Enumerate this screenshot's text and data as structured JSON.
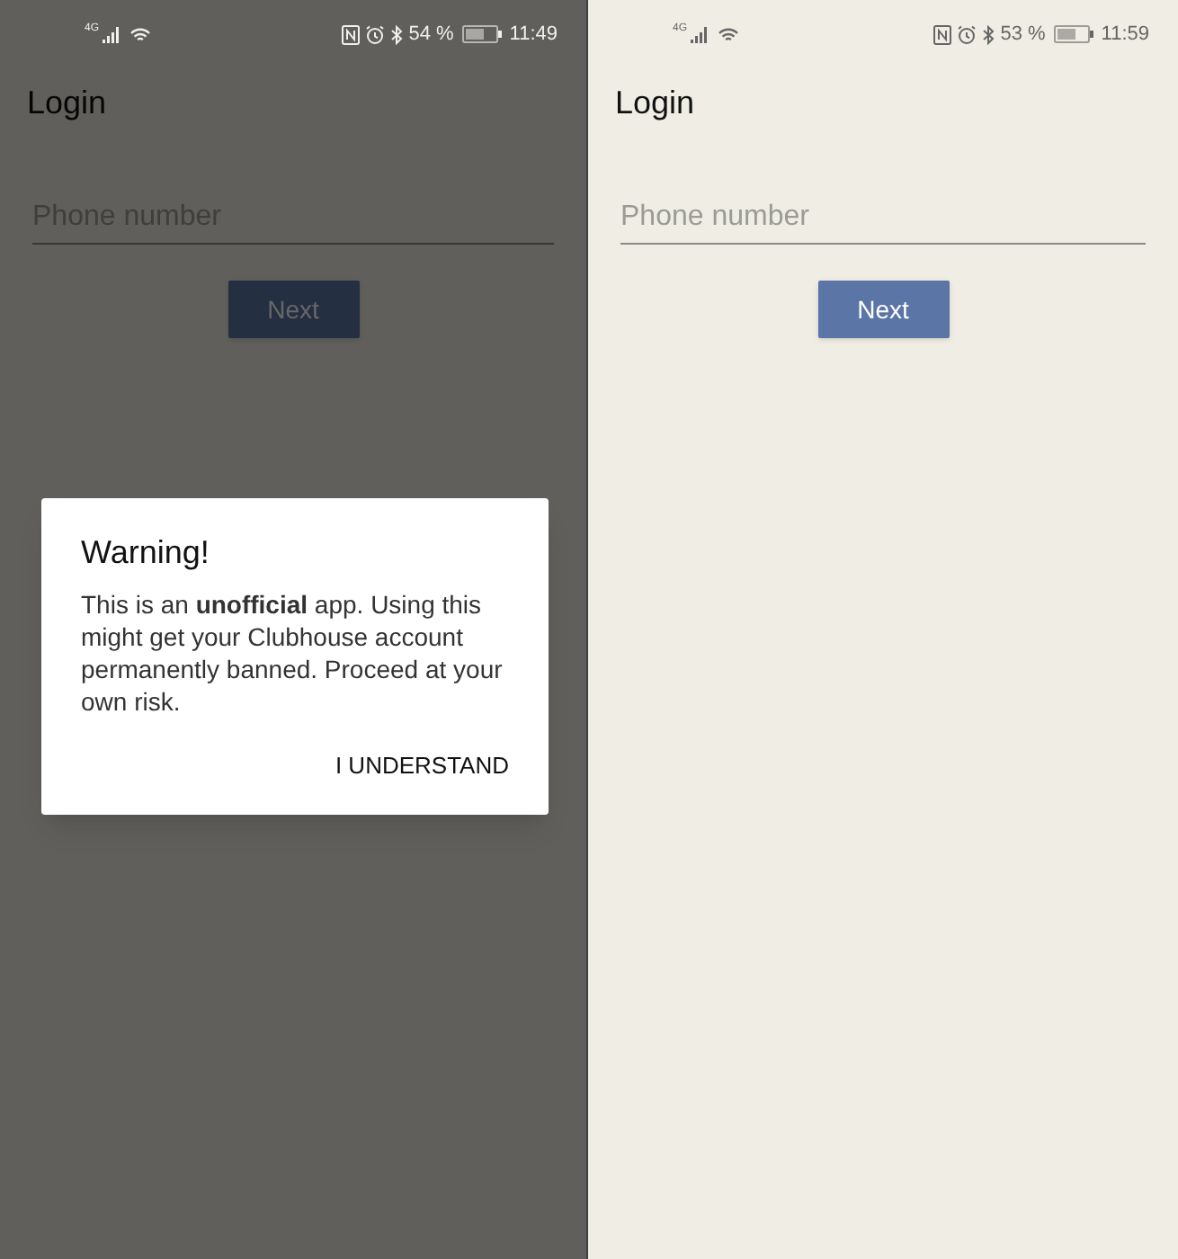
{
  "screens": [
    {
      "status_bar": {
        "network": "4G",
        "battery": "54 %",
        "time": "11:49"
      },
      "title": "Login",
      "phone_field": {
        "placeholder": "Phone number"
      },
      "next_button": "Next",
      "dialog": {
        "title": "Warning!",
        "message": "This is an **unofficial** app. Using this might get your Clubhouse account permanently banned. Proceed at your own risk.",
        "button": "I UNDERSTAND"
      }
    },
    {
      "status_bar": {
        "network": "4G",
        "battery": "53 %",
        "time": "11:59"
      },
      "title": "Login",
      "phone_field": {
        "placeholder": "Phone number"
      },
      "next_button": "Next"
    }
  ]
}
